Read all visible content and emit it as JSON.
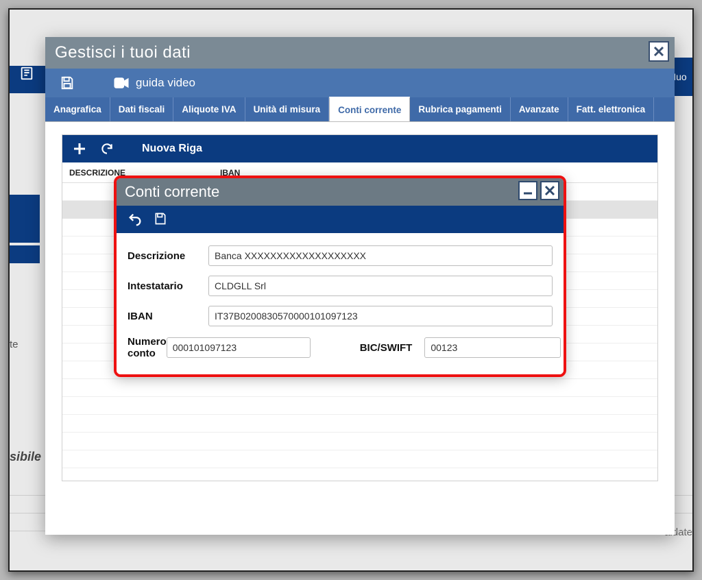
{
  "bg": {
    "right_pill": "Nuo",
    "left_text_1": "te",
    "left_text_2": "sibile",
    "right_text": "aldate"
  },
  "dialog": {
    "title": "Gestisci i tuoi dati",
    "toolbar": {
      "guida_label": "guida video"
    },
    "tabs": [
      {
        "label": "Anagrafica"
      },
      {
        "label": "Dati fiscali"
      },
      {
        "label": "Aliquote IVA"
      },
      {
        "label": "Unità di misura"
      },
      {
        "label": "Conti corrente",
        "active": true
      },
      {
        "label": "Rubrica pagamenti"
      },
      {
        "label": "Avanzate"
      },
      {
        "label": "Fatt. elettronica"
      }
    ],
    "grid": {
      "toolbar_title": "Nuova Riga",
      "columns": {
        "col1": "DESCRIZIONE",
        "col2": "IBAN"
      }
    }
  },
  "inner": {
    "title": "Conti corrente",
    "fields": {
      "descrizione_label": "Descrizione",
      "descrizione_value": "Banca XXXXXXXXXXXXXXXXXXX",
      "intestatario_label": "Intestatario",
      "intestatario_value": "CLDGLL Srl",
      "iban_label": "IBAN",
      "iban_value": "IT37B0200830570000101097123",
      "numero_label": "Numero conto",
      "numero_value": "000101097123",
      "bic_label": "BIC/SWIFT",
      "bic_value": "00123"
    }
  }
}
